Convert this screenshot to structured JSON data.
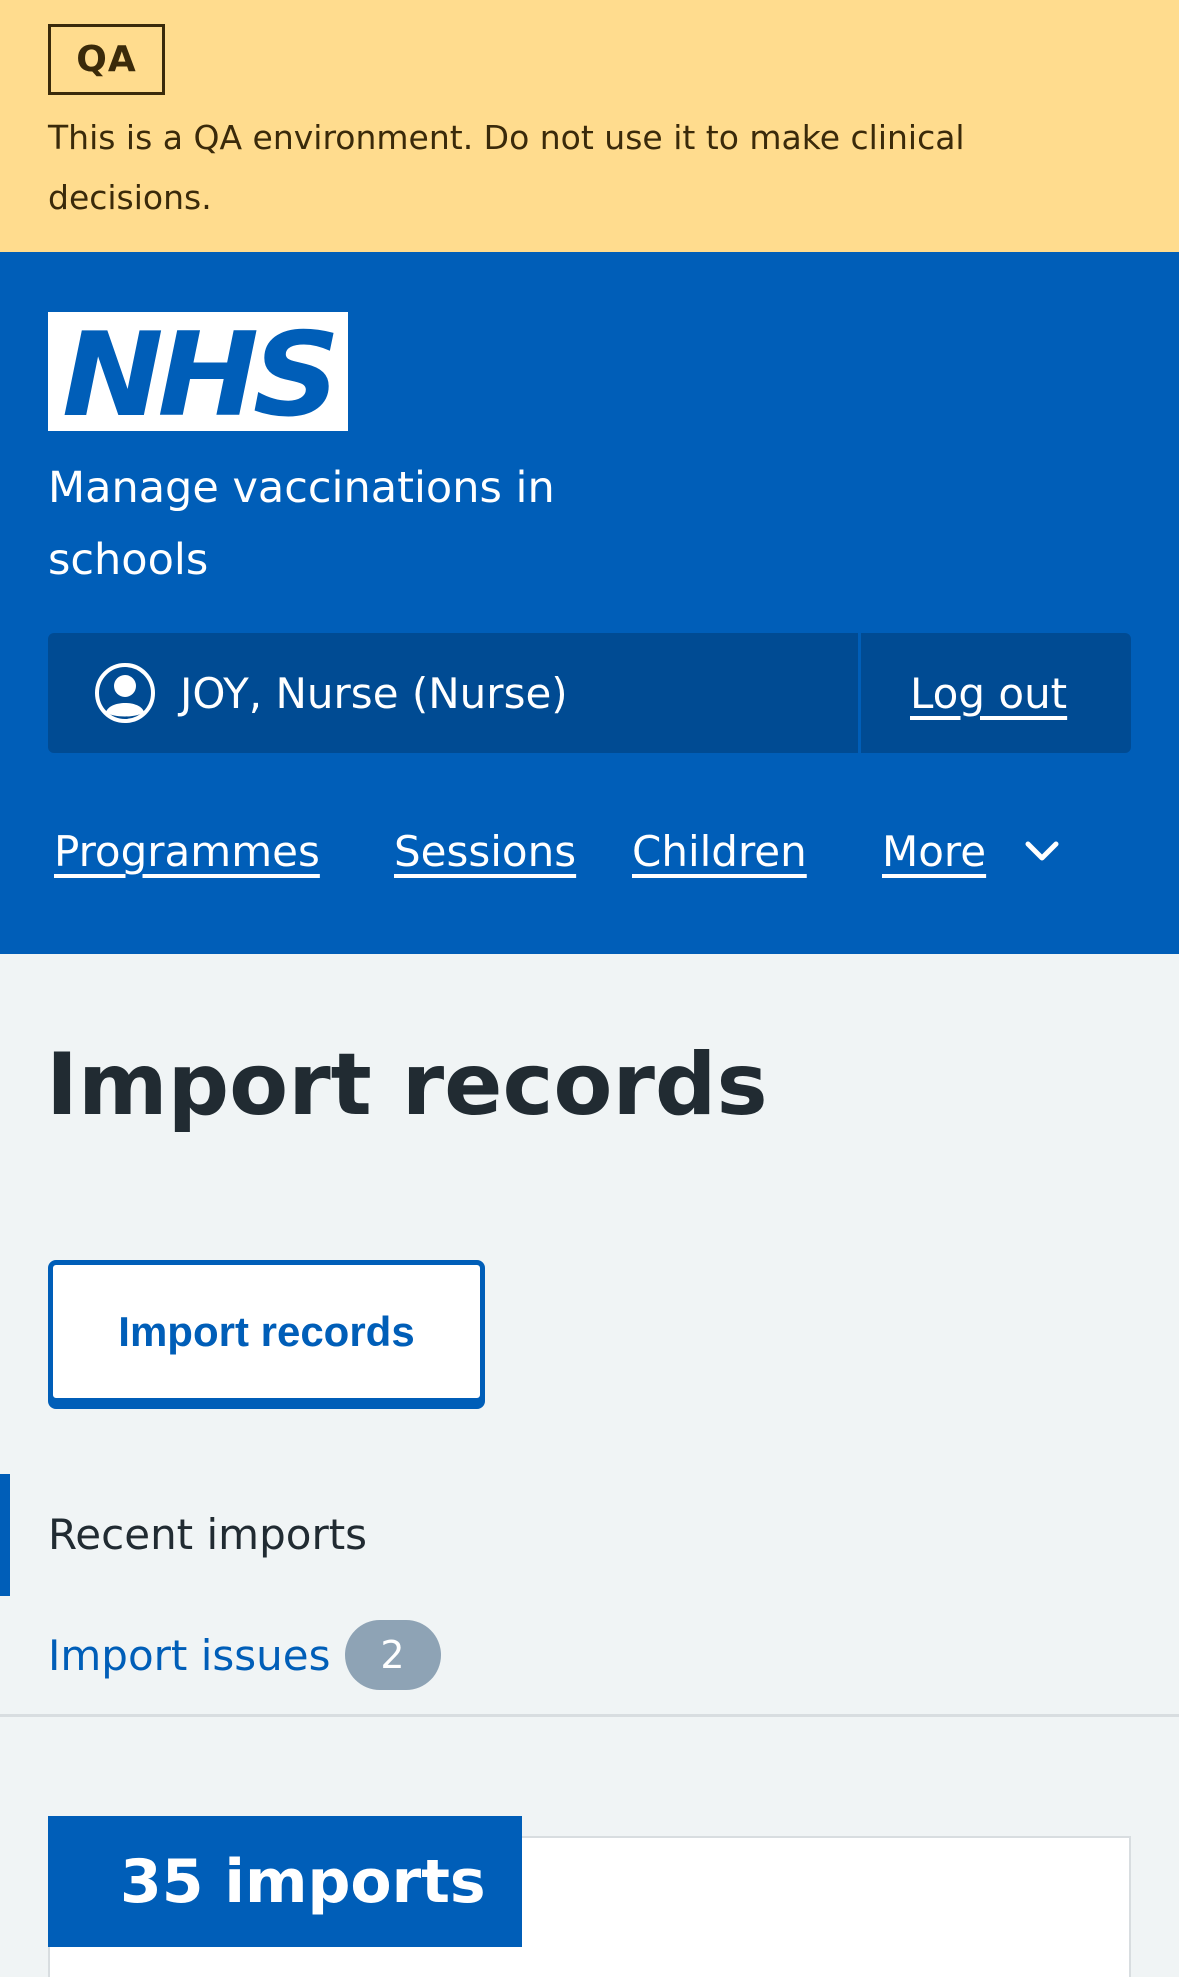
{
  "qa_banner": {
    "tag": "QA",
    "message": "This is a QA environment. Do not use it to make clinical decisions."
  },
  "header": {
    "logo_text": "NHS",
    "service_name": "Manage vaccinations in schools",
    "account": {
      "user_icon": "user-circle-icon",
      "user_name": "JOY, Nurse (Nurse)",
      "logout_label": "Log out"
    },
    "nav": {
      "items": [
        {
          "label": "Programmes"
        },
        {
          "label": "Sessions"
        },
        {
          "label": "Children"
        },
        {
          "label": "More"
        }
      ],
      "more_icon": "chevron-down-icon"
    }
  },
  "main": {
    "title": "Import records",
    "import_button_label": "Import records",
    "secondary_nav": {
      "current": "Recent imports",
      "items": [
        {
          "label": "Import issues",
          "count": "2"
        }
      ]
    },
    "card": {
      "heading": "35 imports"
    }
  },
  "colors": {
    "nhs_blue": "#005eb8",
    "qa_yellow": "#ffdc8e",
    "dark_blue": "#004b93",
    "background": "#f0f4f5",
    "text": "#212b32",
    "badge_grey": "#8ea3b5"
  }
}
